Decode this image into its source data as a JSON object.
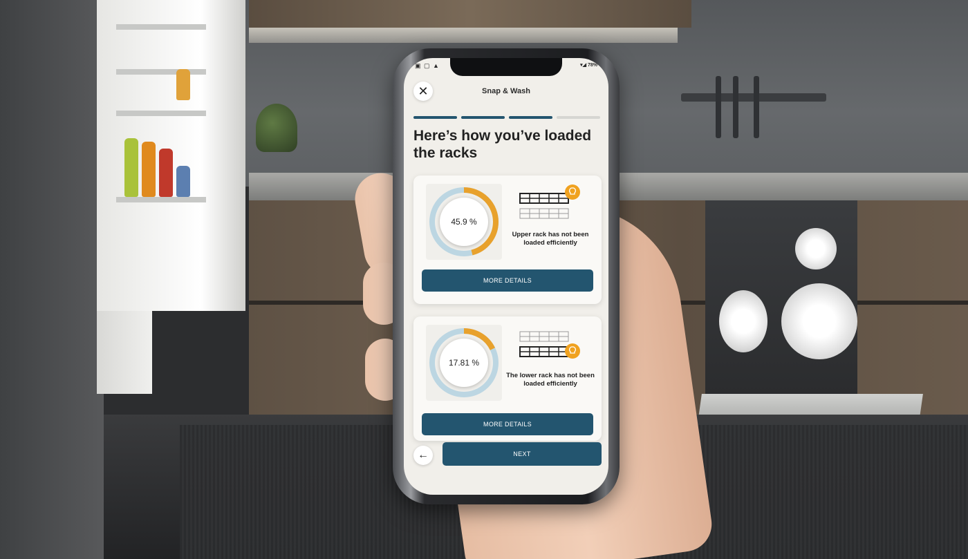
{
  "app": {
    "title": "Snap & Wash",
    "status_left": "▣ ▢ ▲",
    "status_right": "▾◢ 78%"
  },
  "progress": {
    "steps_total": 4,
    "steps_completed": 3,
    "active_color": "#23556f"
  },
  "heading": "Here’s how you’ve loaded the racks",
  "racks": [
    {
      "percent_label": "45.9 %",
      "percent_value": 45.9,
      "rack": "upper",
      "message": "Upper rack has not been loaded efficiently",
      "button_label": "MORE DETAILS",
      "icon": "upper-rack-bulb-icon"
    },
    {
      "percent_label": "17.81 %",
      "percent_value": 17.81,
      "rack": "lower",
      "message": "The lower rack has not been loaded efficiently",
      "button_label": "MORE DETAILS",
      "icon": "lower-rack-bulb-icon"
    }
  ],
  "nav": {
    "back_icon": "←",
    "next_label": "NEXT"
  },
  "icons": {
    "close": "✕",
    "close_name": "close-icon",
    "back_name": "back-arrow-icon"
  },
  "colors": {
    "accent": "#23556f",
    "gauge_fill": "#e8a12c",
    "gauge_track": "#bcd6e2",
    "bulb": "#f0a21f"
  }
}
